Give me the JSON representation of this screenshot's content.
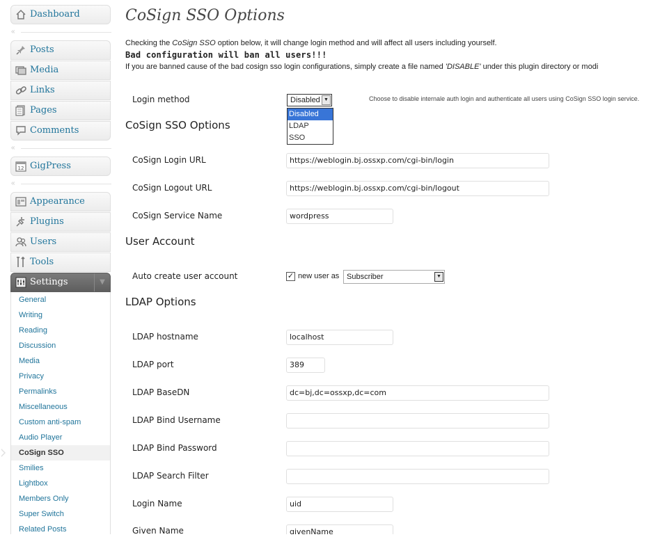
{
  "sidebar": {
    "dashboard": "Dashboard",
    "posts": "Posts",
    "media": "Media",
    "links": "Links",
    "pages": "Pages",
    "comments": "Comments",
    "gigpress": "GigPress",
    "appearance": "Appearance",
    "plugins": "Plugins",
    "users": "Users",
    "tools": "Tools",
    "settings": "Settings",
    "settings_submenu": [
      "General",
      "Writing",
      "Reading",
      "Discussion",
      "Media",
      "Privacy",
      "Permalinks",
      "Miscellaneous",
      "Custom anti-spam",
      "Audio Player",
      "CoSign SSO",
      "Smilies",
      "Lightbox",
      "Members Only",
      "Super Switch",
      "Related Posts"
    ],
    "current_submenu": "CoSign SSO"
  },
  "page": {
    "title": "CoSign SSO Options",
    "notice_line1_a": "Checking the ",
    "notice_line1_em": "CoSign SSO",
    "notice_line1_b": " option below, it will change login method and will affect all users including yourself.",
    "notice_bold": "Bad configuration will ban all users!!!",
    "notice_line3_a": "If you are banned cause of the bad cosign sso login configurations, simply create a file named ",
    "notice_line3_em": "'DISABLE'",
    "notice_line3_b": " under this plugin directory or modi"
  },
  "login_method": {
    "label": "Login method",
    "value": "Disabled",
    "options": [
      "Disabled",
      "LDAP",
      "SSO"
    ],
    "help": "Choose to disable internale auth login and authenticate all users using CoSign SSO login service."
  },
  "cosign": {
    "section": "CoSign SSO Options",
    "login_url_label": "CoSign Login URL",
    "login_url_value": "https://weblogin.bj.ossxp.com/cgi-bin/login",
    "logout_url_label": "CoSign Logout URL",
    "logout_url_value": "https://weblogin.bj.ossxp.com/cgi-bin/logout",
    "service_label": "CoSign Service Name",
    "service_value": "wordpress"
  },
  "user_account": {
    "section": "User Account",
    "auto_label": "Auto create user account",
    "checkbox_label": "new user as",
    "checked": true,
    "role_value": "Subscriber"
  },
  "ldap": {
    "section": "LDAP Options",
    "hostname_label": "LDAP hostname",
    "hostname_value": "localhost",
    "port_label": "LDAP port",
    "port_value": "389",
    "basedn_label": "LDAP BaseDN",
    "basedn_value": "dc=bj,dc=ossxp,dc=com",
    "bind_user_label": "LDAP Bind Username",
    "bind_user_value": "",
    "bind_pass_label": "LDAP Bind Password",
    "bind_pass_value": "",
    "filter_label": "LDAP Search Filter",
    "filter_value": "",
    "login_name_label": "Login Name",
    "login_name_value": "uid",
    "given_name_label": "Given Name",
    "given_name_value": "givenName"
  }
}
